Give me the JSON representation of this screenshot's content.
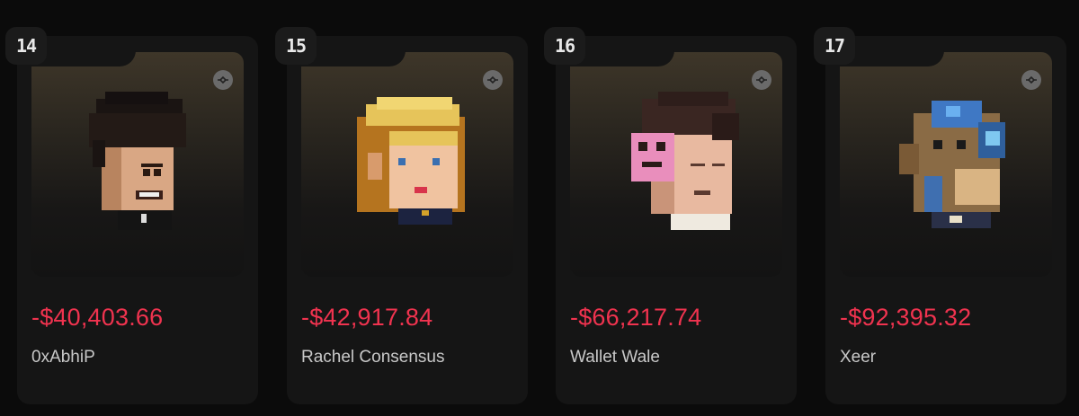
{
  "cards": [
    {
      "rank": "14",
      "pnl": "-$40,403.66",
      "name": "0xAbhiP",
      "avatar": "curly-hair-avatar-icon"
    },
    {
      "rank": "15",
      "pnl": "-$42,917.84",
      "name": "Rachel Consensus",
      "avatar": "blonde-avatar-icon"
    },
    {
      "rank": "16",
      "pnl": "-$66,217.74",
      "name": "Wallet Wale",
      "avatar": "pink-mask-avatar-icon"
    },
    {
      "rank": "17",
      "pnl": "-$92,395.32",
      "name": "Xeer",
      "avatar": "robot-monkey-avatar-icon"
    }
  ],
  "colors": {
    "loss": "#f0334f",
    "card_bg": "#151515",
    "page_bg": "#0b0b0b"
  },
  "icons": {
    "badge": "link-icon"
  }
}
